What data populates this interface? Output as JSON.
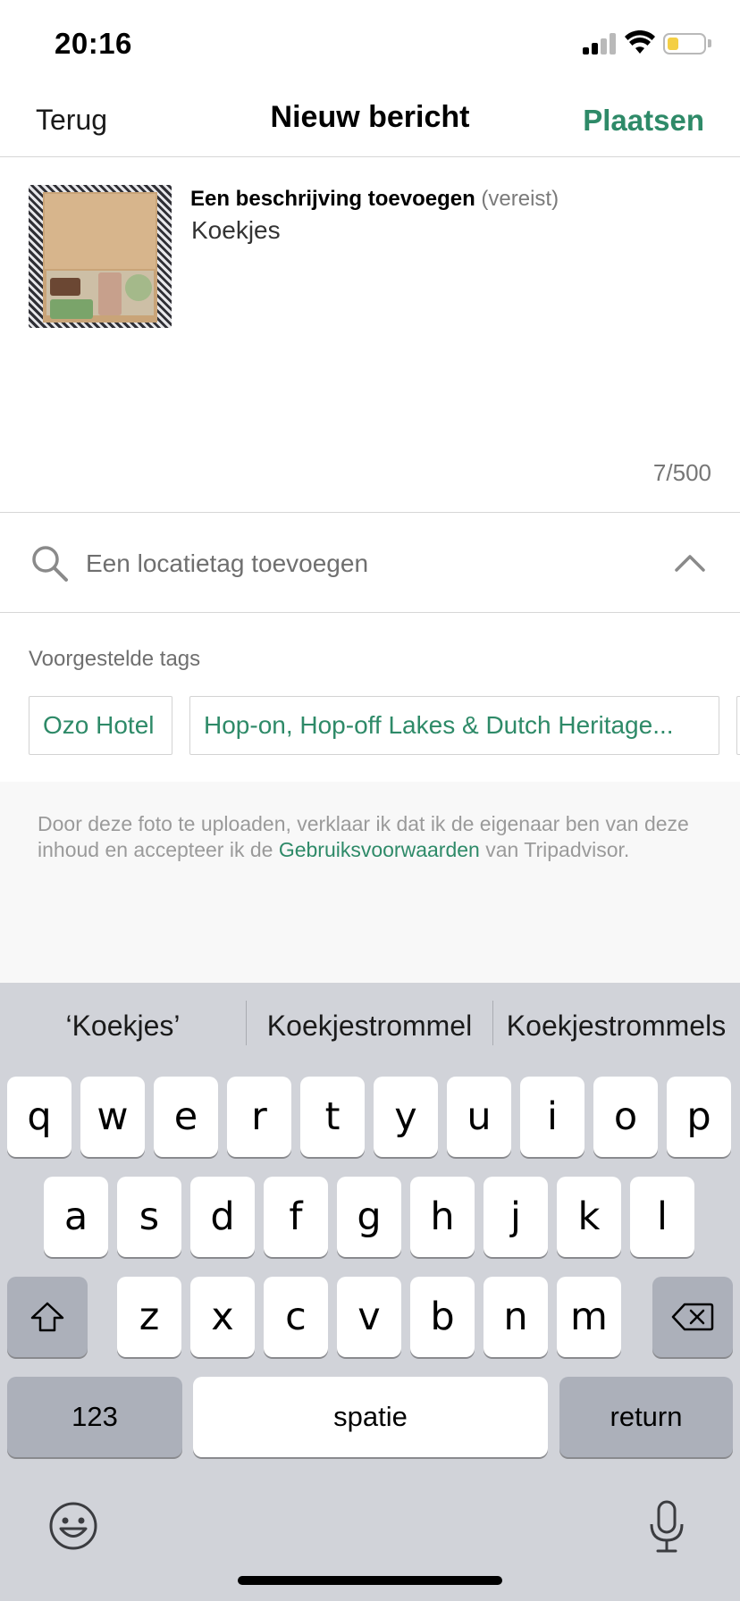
{
  "status_bar": {
    "time": "20:16",
    "battery_color": "#f4cf45"
  },
  "nav": {
    "back_label": "Terug",
    "title": "Nieuw bericht",
    "post_label": "Plaatsen",
    "accent_color": "#2e8a68"
  },
  "description": {
    "label": "Een beschrijving toevoegen",
    "required_note": "(vereist)",
    "value": "Koekjes",
    "char_count": "7/500"
  },
  "location": {
    "placeholder": "Een locatietag toevoegen"
  },
  "suggested_tags": {
    "title": "Voorgestelde tags",
    "items": [
      "Ozo Hotel",
      "Hop-on, Hop-off Lakes & Dutch Heritage..."
    ]
  },
  "legal": {
    "text_before": "Door deze foto te uploaden, verklaar ik dat ik de eigenaar ben van deze inhoud en accepteer ik de",
    "link": "Gebruiksvoorwaarden",
    "text_after": "van Tripadvisor."
  },
  "keyboard": {
    "suggestions": [
      "‘Koekjes’",
      "Koekjestrommel",
      "Koekjestrommels"
    ],
    "row1": [
      "q",
      "w",
      "e",
      "r",
      "t",
      "y",
      "u",
      "i",
      "o",
      "p"
    ],
    "row2": [
      "a",
      "s",
      "d",
      "f",
      "g",
      "h",
      "j",
      "k",
      "l"
    ],
    "row3": [
      "z",
      "x",
      "c",
      "v",
      "b",
      "n",
      "m"
    ],
    "numbers_key": "123",
    "space_key": "spatie",
    "return_key": "return"
  }
}
